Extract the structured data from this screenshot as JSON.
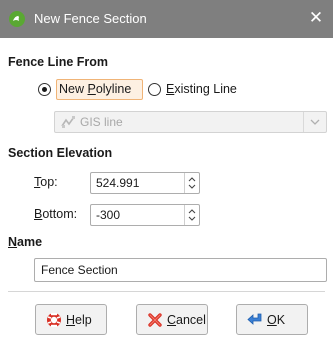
{
  "window": {
    "title": "New Fence Section",
    "app_icon": "leapfrog-icon",
    "close_glyph": "✕",
    "titlebar_color": "#7f7f7f"
  },
  "fence_line_from": {
    "label": "Fence Line From",
    "options": [
      {
        "label": "New Polyline",
        "mnemonic": "P",
        "selected": true
      },
      {
        "label": "Existing Line",
        "mnemonic": "E",
        "selected": false
      }
    ],
    "line_select": {
      "icon": "gis-line-icon",
      "value": "GIS line",
      "enabled": false
    }
  },
  "section_elevation": {
    "label": "Section Elevation",
    "top": {
      "label": "Top:",
      "mnemonic": "T",
      "value": "524.991"
    },
    "bottom": {
      "label": "Bottom:",
      "mnemonic": "B",
      "value": "-300"
    }
  },
  "name": {
    "label": "Name",
    "mnemonic": "N",
    "value": "Fence Section"
  },
  "buttons": {
    "help": {
      "label": "Help",
      "mnemonic": "H",
      "icon": "help-lifebuoy-icon"
    },
    "cancel": {
      "label": "Cancel",
      "mnemonic": "C",
      "icon": "cancel-x-icon"
    },
    "ok": {
      "label": "OK",
      "mnemonic": "O",
      "icon": "ok-arrow-icon"
    }
  },
  "colors": {
    "focus_border": "#f0b477",
    "focus_fill": "#fdf0e2",
    "accent_green": "#5aa832"
  }
}
